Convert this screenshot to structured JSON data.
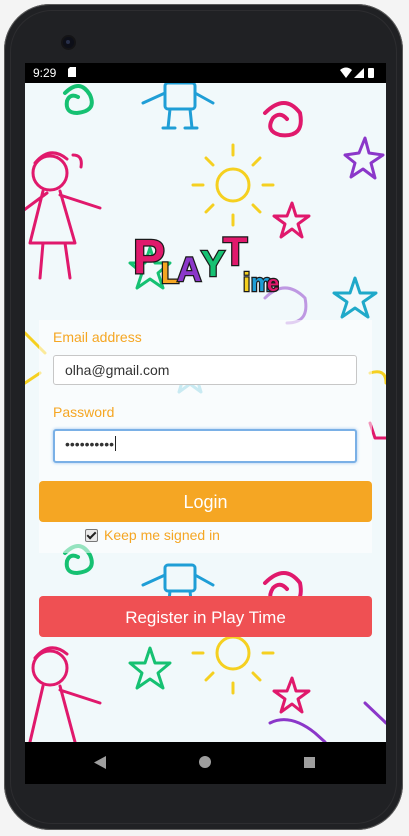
{
  "status_bar": {
    "time": "9:29"
  },
  "app": {
    "logo_text": "PLAYTIME"
  },
  "login_form": {
    "email_label": "Email address",
    "email_value": "olha@gmail.com",
    "password_label": "Password",
    "password_value": "••••••••••",
    "login_label": "Login",
    "keep_signed_in_label": "Keep me signed in",
    "keep_signed_in_checked": true
  },
  "register_label": "Register in Play Time",
  "colors": {
    "accent_orange": "#f5a623",
    "register_red": "#ef5053",
    "screen_bg": "#f1f9fb"
  },
  "icons": [
    "sd-card-icon",
    "wifi-icon",
    "signal-icon",
    "battery-icon",
    "back-icon",
    "home-icon",
    "recents-icon"
  ]
}
